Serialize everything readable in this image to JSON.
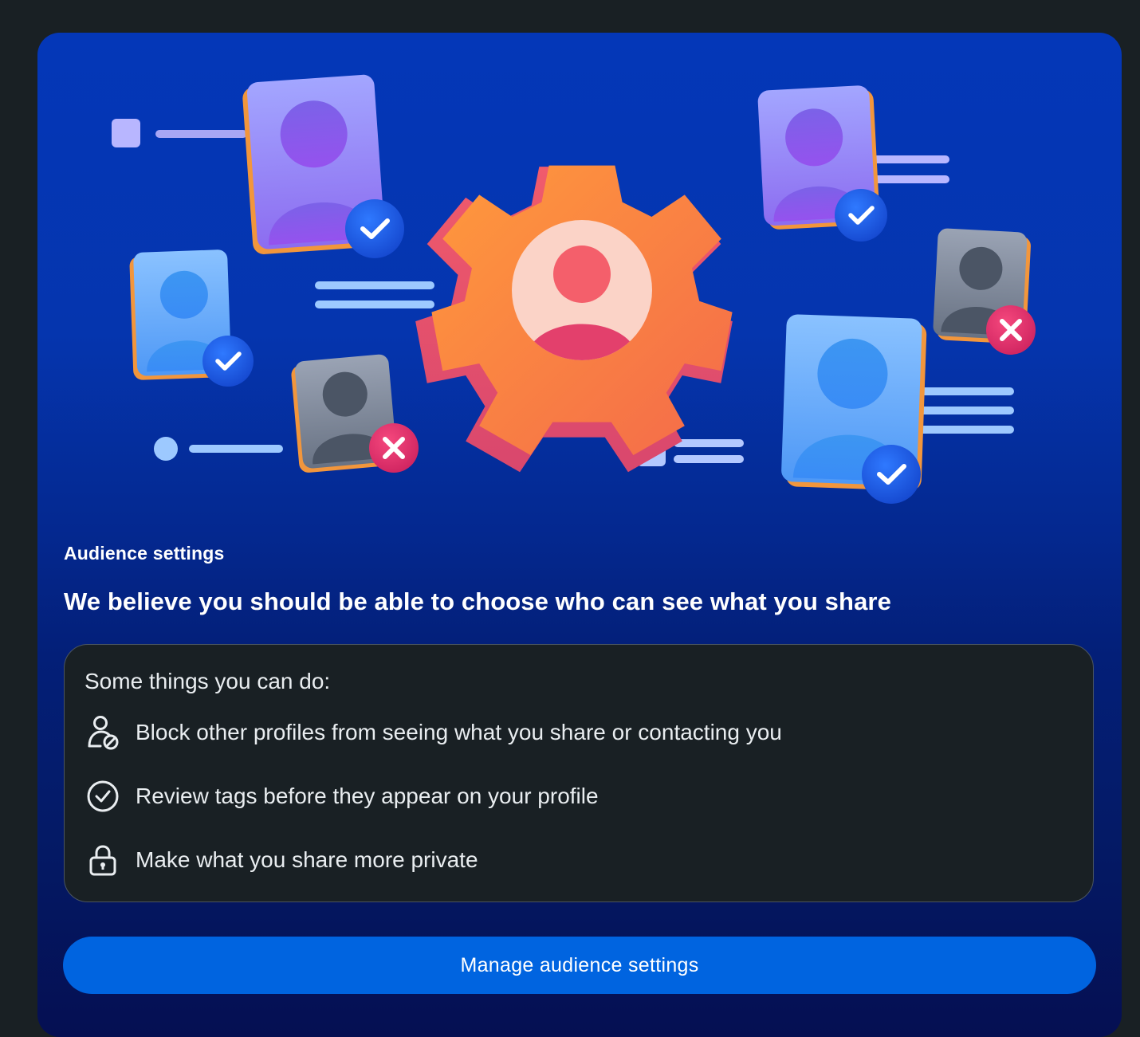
{
  "card": {
    "eyebrow": "Audience settings",
    "headline": "We believe you should be able to choose who can see what you share"
  },
  "things": {
    "intro": "Some things you can do:",
    "items": [
      {
        "icon": "user-block-icon",
        "label": "Block other profiles from seeing what you share or contacting you"
      },
      {
        "icon": "check-circle-icon",
        "label": "Review tags before they appear on your profile"
      },
      {
        "icon": "lock-icon",
        "label": "Make what you share more private"
      }
    ]
  },
  "action": {
    "button_label": "Manage audience settings"
  },
  "colors": {
    "page_background": "#192024",
    "card_gradient_top": "#0437b8",
    "card_gradient_bottom": "#050f52",
    "button_blue": "#0064e0",
    "gear_orange": "#f7873a",
    "approved_badge": "#1f5be6",
    "blocked_badge": "#e5326e"
  }
}
